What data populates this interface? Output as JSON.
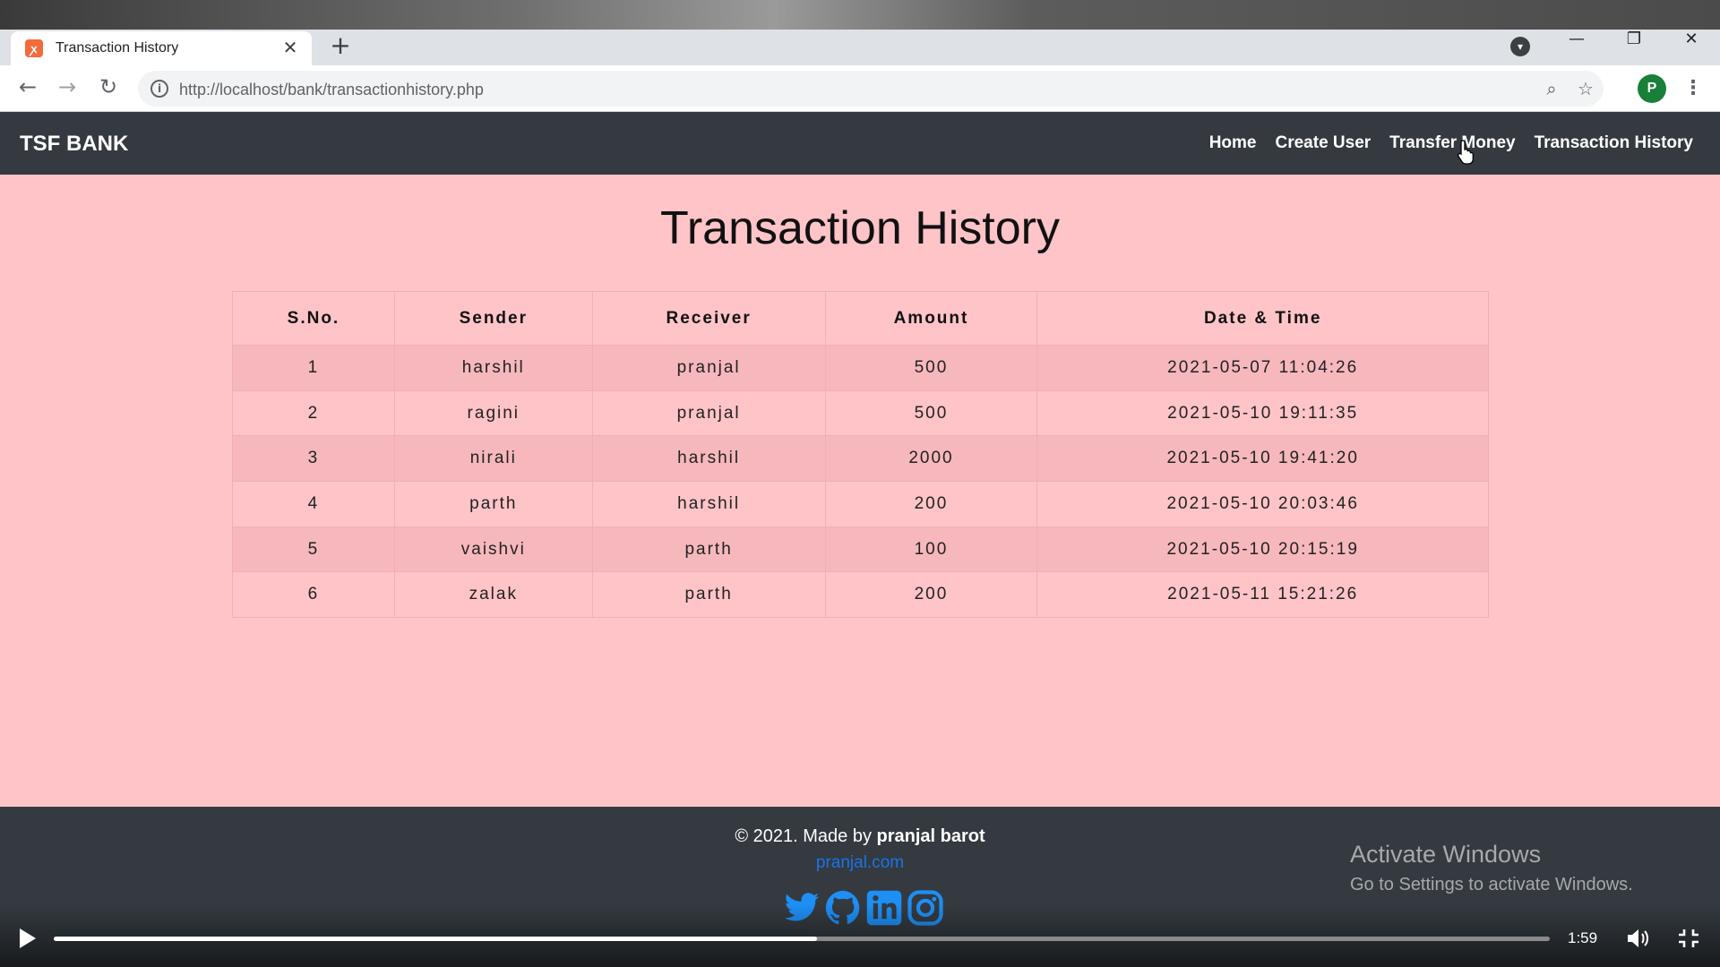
{
  "browser": {
    "tab_title": "Transaction History",
    "tab_favicon": "xampp-favicon-icon",
    "new_tab_label": "+",
    "url": "http://localhost/bank/transactionhistory.php",
    "profile_initial": "P",
    "profile_color": "#188038"
  },
  "site": {
    "brand": "TSF BANK",
    "nav": [
      {
        "label": "Home"
      },
      {
        "label": "Create User"
      },
      {
        "label": "Transfer Money"
      },
      {
        "label": "Transaction History"
      }
    ]
  },
  "main": {
    "title": "Transaction History",
    "table": {
      "headers": [
        "S.No.",
        "Sender",
        "Receiver",
        "Amount",
        "Date & Time"
      ],
      "rows": [
        [
          "1",
          "harshil",
          "pranjal",
          "500",
          "2021-05-07 11:04:26"
        ],
        [
          "2",
          "ragini",
          "pranjal",
          "500",
          "2021-05-10 19:11:35"
        ],
        [
          "3",
          "nirali",
          "harshil",
          "2000",
          "2021-05-10 19:41:20"
        ],
        [
          "4",
          "parth",
          "harshil",
          "200",
          "2021-05-10 20:03:46"
        ],
        [
          "5",
          "vaishvi",
          "parth",
          "100",
          "2021-05-10 20:15:19"
        ],
        [
          "6",
          "zalak",
          "parth",
          "200",
          "2021-05-11 15:21:26"
        ]
      ]
    }
  },
  "footer": {
    "copyright_prefix": "© 2021. Made by ",
    "author": "pranjal barot",
    "site_link": "pranjal.com",
    "socials": [
      "twitter-icon",
      "github-icon",
      "linkedin-icon",
      "instagram-icon"
    ]
  },
  "watermark": {
    "title": "Activate Windows",
    "subtitle": "Go to Settings to activate Windows."
  },
  "video": {
    "time": "1:59",
    "progress": 0.51
  },
  "colors": {
    "page_bg": "#ffc4c8",
    "nav_bg": "#343a40",
    "link": "#1a73e8",
    "social": "#1d8ff5"
  }
}
